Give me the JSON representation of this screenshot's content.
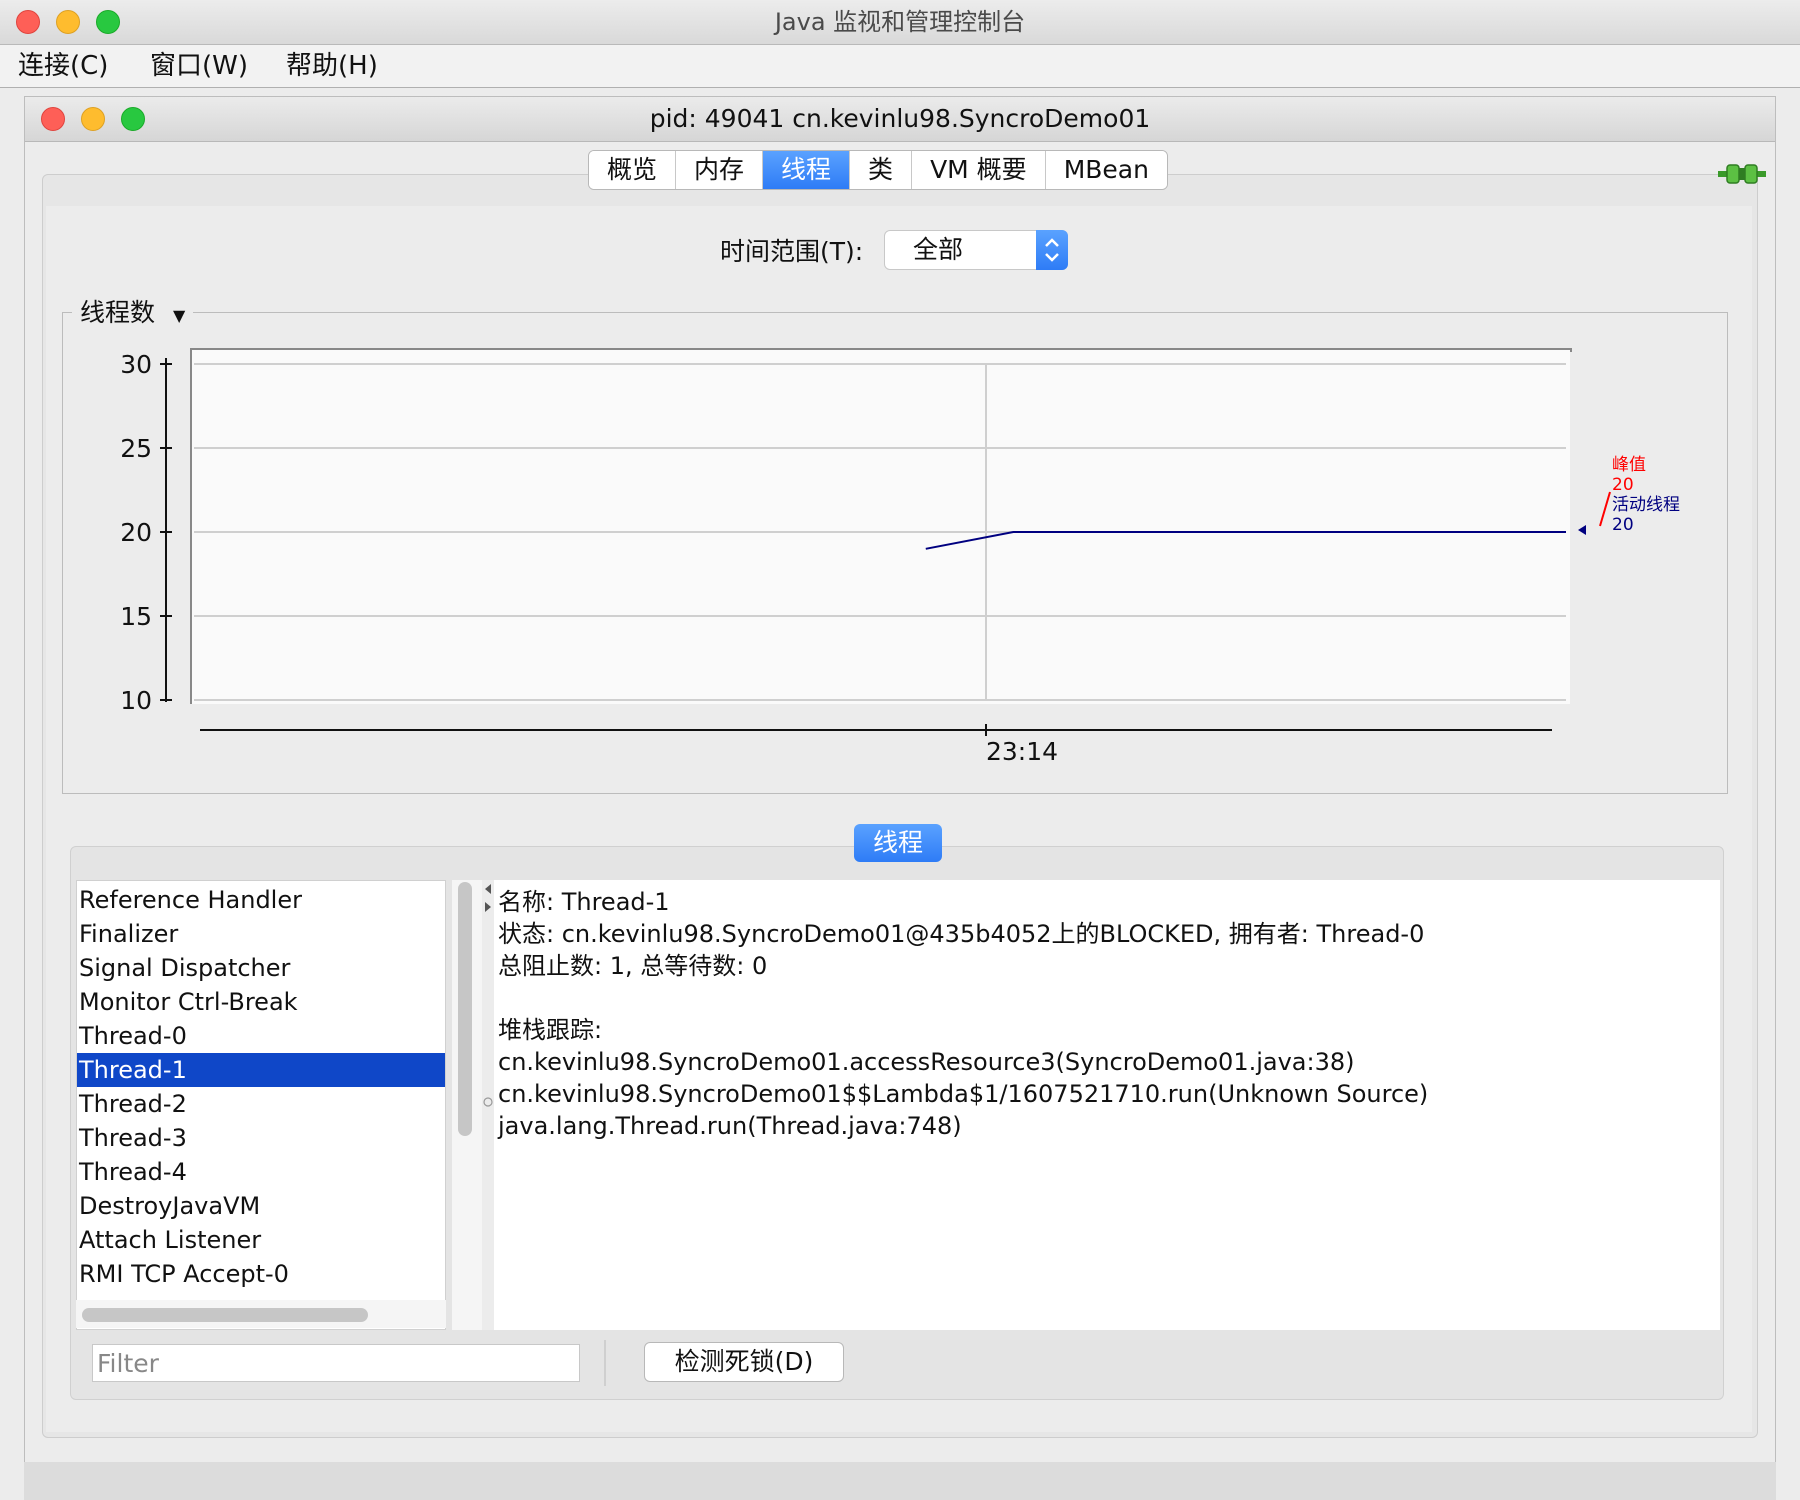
{
  "window": {
    "title": "Java 监视和管理控制台"
  },
  "menu": {
    "items": [
      "连接(C)",
      "窗口(W)",
      "帮助(H)"
    ]
  },
  "inner_window": {
    "title": "pid: 49041 cn.kevinlu98.SyncroDemo01"
  },
  "tabs": [
    {
      "label": "概览",
      "active": false
    },
    {
      "label": "内存",
      "active": false
    },
    {
      "label": "线程",
      "active": true
    },
    {
      "label": "类",
      "active": false
    },
    {
      "label": "VM 概要",
      "active": false
    },
    {
      "label": "MBean",
      "active": false
    }
  ],
  "time_range": {
    "label": "时间范围(T):",
    "value": "全部"
  },
  "chart_panel": {
    "title": "线程数"
  },
  "chart_data": {
    "type": "line",
    "ylim": [
      10,
      30
    ],
    "yticks": [
      "30",
      "25",
      "20",
      "15",
      "10"
    ],
    "xtick": "23:14",
    "series": [
      {
        "name": "活动线程",
        "color": "#000080",
        "points": [
          [
            0.532,
            19
          ],
          [
            0.596,
            20
          ],
          [
            1.0,
            20
          ]
        ]
      }
    ],
    "legend": [
      {
        "label": "峰值",
        "value": "20",
        "color": "#ff0000"
      },
      {
        "label": "活动线程",
        "value": "20",
        "color": "#000080"
      }
    ]
  },
  "threads": {
    "header": "线程",
    "list": [
      "Reference Handler",
      "Finalizer",
      "Signal Dispatcher",
      "Monitor Ctrl-Break",
      "Thread-0",
      "Thread-1",
      "Thread-2",
      "Thread-3",
      "Thread-4",
      "DestroyJavaVM",
      "Attach Listener",
      "RMI TCP Accept-0"
    ],
    "selected_index": 5,
    "filter_placeholder": "Filter",
    "deadlock_button": "检测死锁(D)"
  },
  "detail": {
    "lines": [
      "名称: Thread-1",
      "状态: cn.kevinlu98.SyncroDemo01@435b4052上的BLOCKED, 拥有者: Thread-0",
      "总阻止数: 1, 总等待数: 0",
      "",
      "堆栈跟踪:",
      "cn.kevinlu98.SyncroDemo01.accessResource3(SyncroDemo01.java:38)",
      "cn.kevinlu98.SyncroDemo01$$Lambda$1/1607521710.run(Unknown Source)",
      "java.lang.Thread.run(Thread.java:748)"
    ]
  }
}
